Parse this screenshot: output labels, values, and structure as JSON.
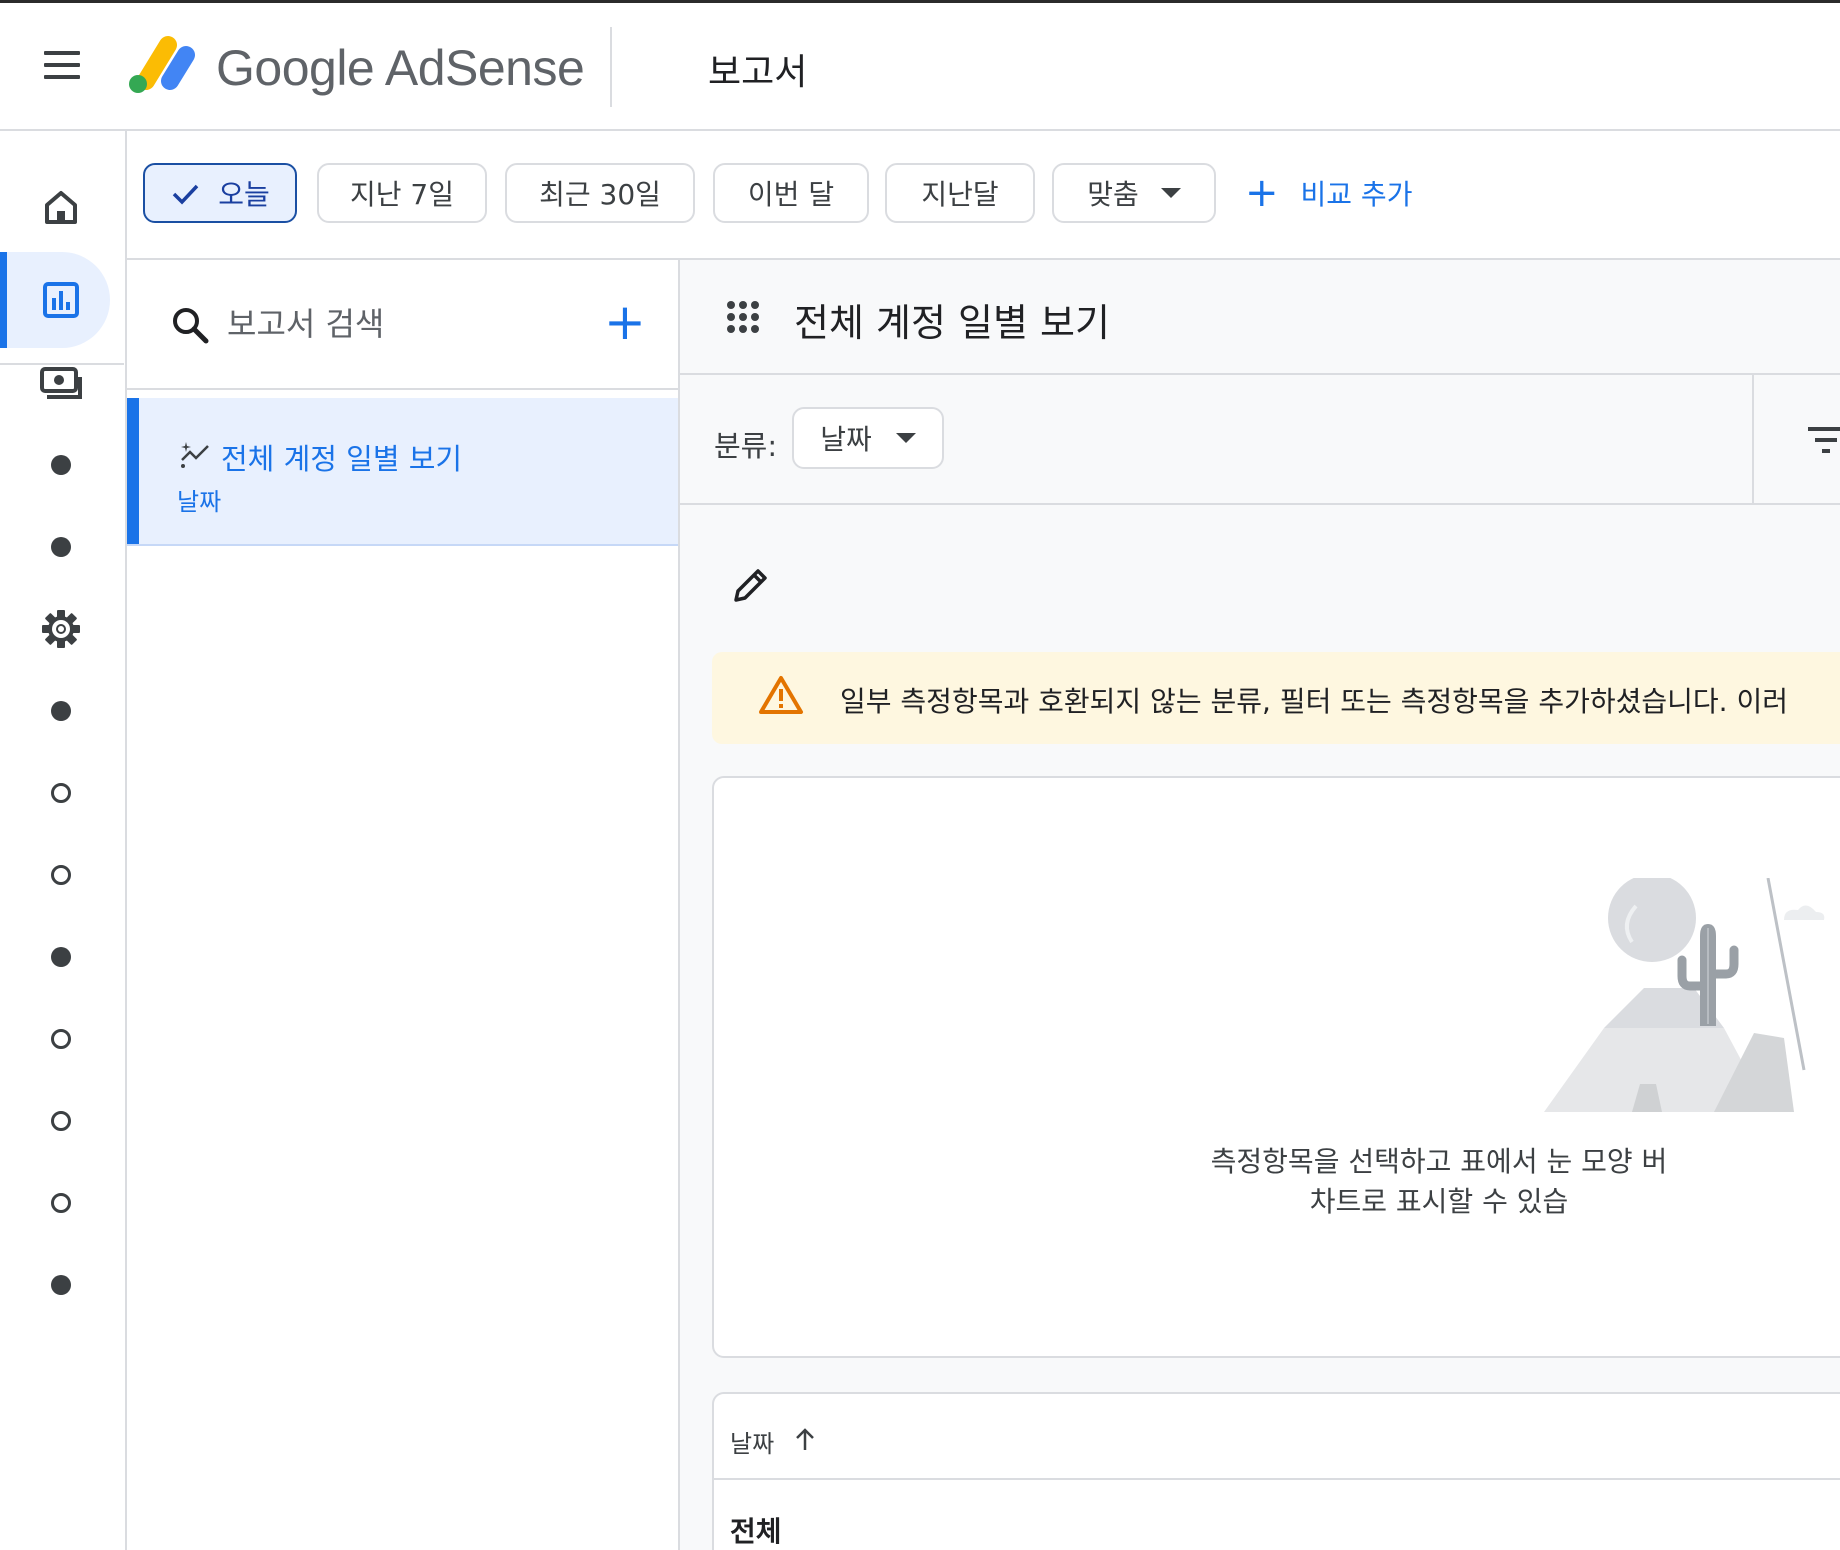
{
  "header": {
    "brand": "Google AdSense",
    "page_title": "보고서"
  },
  "rail": {
    "items": [
      {
        "icon": "home-icon",
        "style": "icon"
      },
      {
        "icon": "reports-icon",
        "style": "icon",
        "active": true
      },
      {
        "icon": "payments-icon",
        "style": "icon"
      },
      {
        "icon": "dot-filled",
        "style": "filled"
      },
      {
        "icon": "dot-filled",
        "style": "filled"
      },
      {
        "icon": "settings-icon",
        "style": "icon"
      },
      {
        "icon": "dot-filled",
        "style": "filled"
      },
      {
        "icon": "dot-outline",
        "style": "outline"
      },
      {
        "icon": "dot-outline",
        "style": "outline"
      },
      {
        "icon": "dot-filled",
        "style": "filled"
      },
      {
        "icon": "dot-outline",
        "style": "outline"
      },
      {
        "icon": "dot-outline",
        "style": "outline"
      },
      {
        "icon": "dot-outline",
        "style": "outline"
      },
      {
        "icon": "dot-filled",
        "style": "filled"
      }
    ]
  },
  "date_chips": {
    "today": "오늘",
    "last7": "지난 7일",
    "last30": "최근 30일",
    "this_month": "이번 달",
    "last_month": "지난달",
    "custom": "맞춤",
    "selected": "today",
    "add_compare": "비교 추가"
  },
  "report_list": {
    "search_placeholder": "보고서 검색",
    "items": [
      {
        "name": "전체 계정 일별 보기",
        "subtitle": "날짜",
        "active": true
      }
    ]
  },
  "report": {
    "title": "전체 계정 일별 보기",
    "breakdown_label": "분류:",
    "breakdown_value": "날짜",
    "warning": "일부 측정항목과 호환되지 않는 분류, 필터 또는 측정항목을 추가하셨습니다. 이러",
    "empty_line1": "측정항목을 선택하고 표에서 눈 모양 버",
    "empty_line2": "차트로 표시할 수 있습",
    "table": {
      "date_header": "날짜",
      "total_label": "전체"
    }
  },
  "colors": {
    "accent": "#1a73e8",
    "selected_chip_bg": "#e8f0fe",
    "warning_bg": "#fef7e0",
    "warning_icon": "#e37400"
  }
}
